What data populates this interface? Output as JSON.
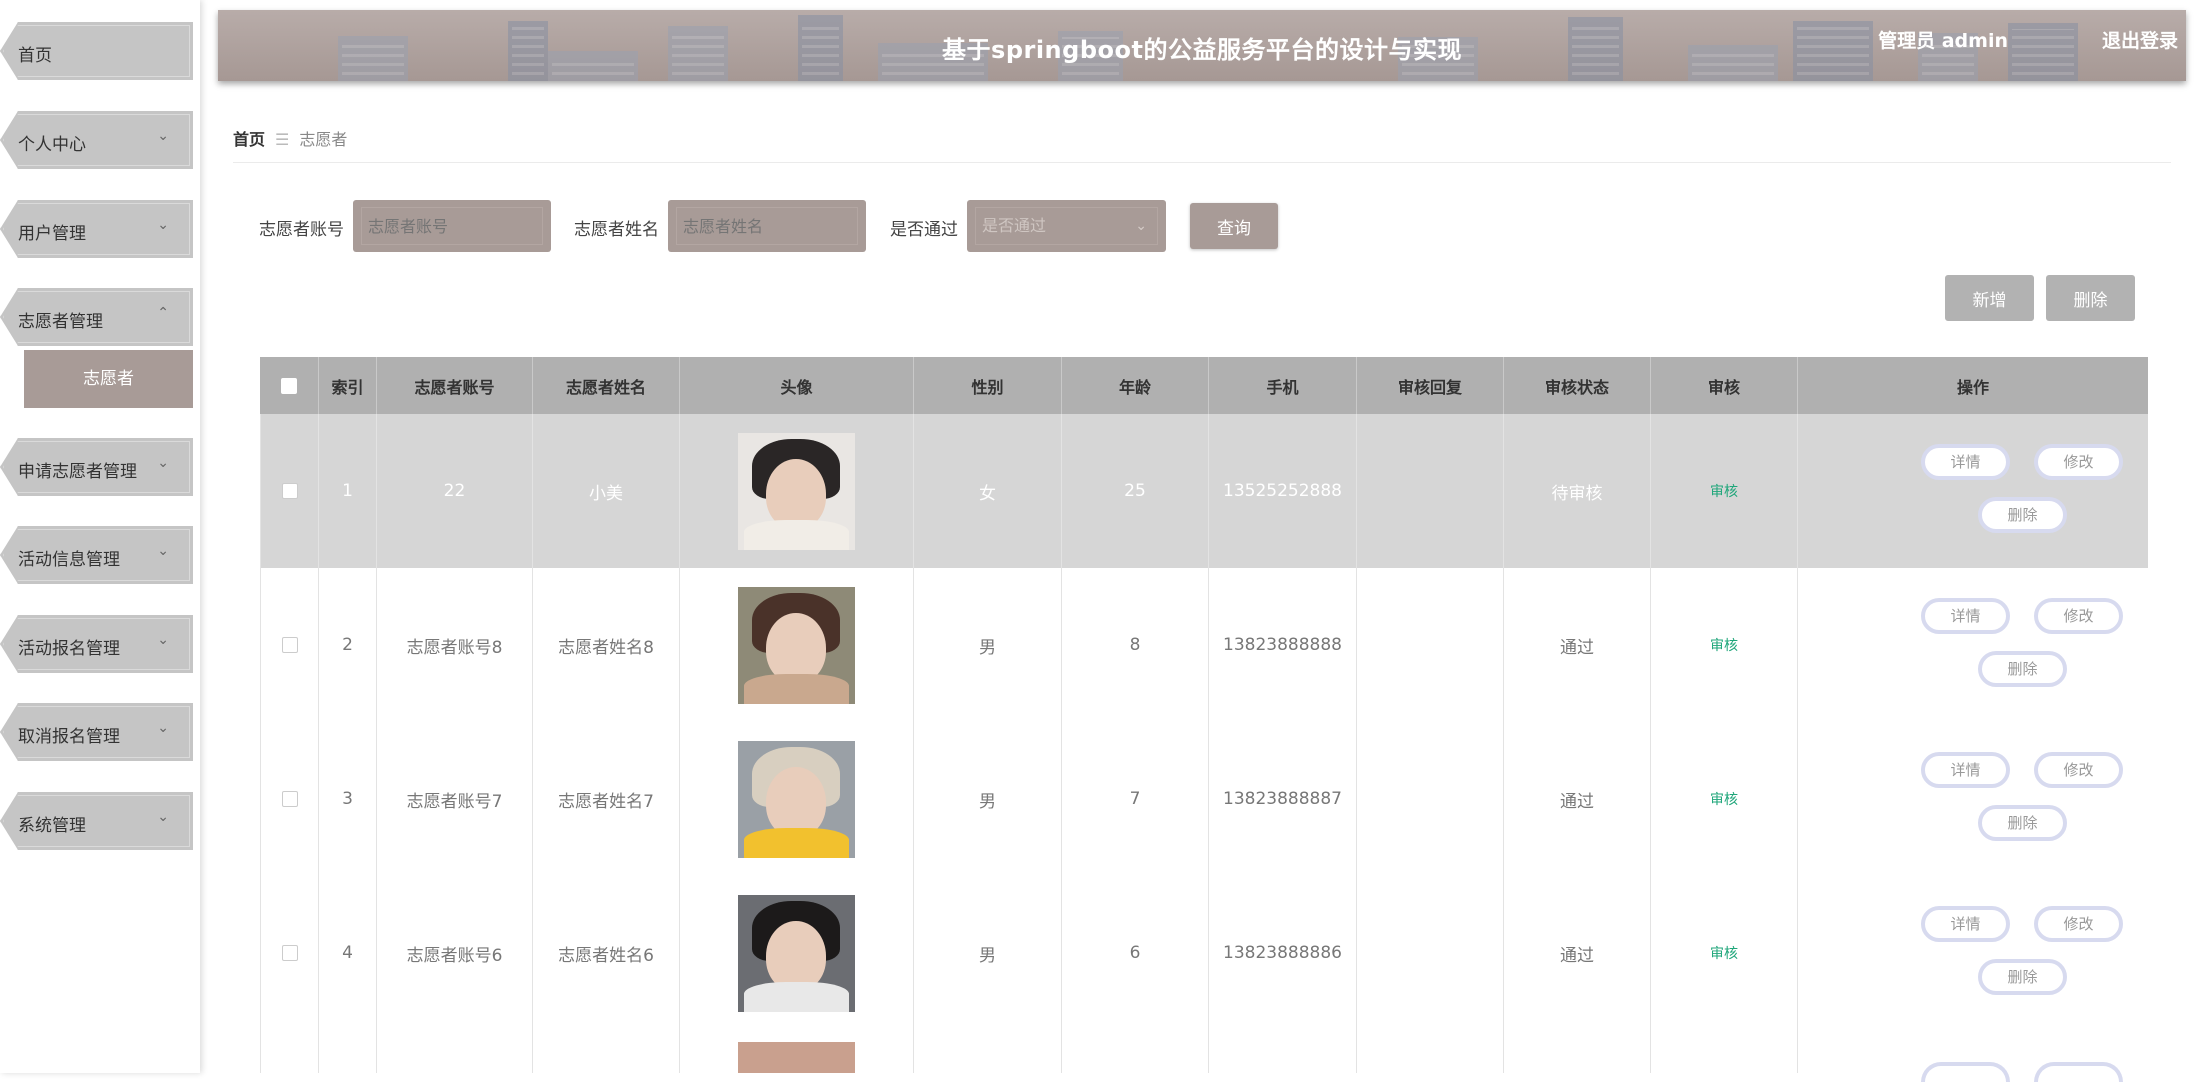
{
  "header": {
    "title": "基于springboot的公益服务平台的设计与实现",
    "user": "管理员 admin",
    "logout": "退出登录"
  },
  "sidebar": {
    "items": [
      {
        "label": "首页",
        "chevron": ""
      },
      {
        "label": "个人中心",
        "chevron": "⌄"
      },
      {
        "label": "用户管理",
        "chevron": "⌄"
      },
      {
        "label": "志愿者管理",
        "chevron": "⌃"
      },
      {
        "label": "申请志愿者管理",
        "chevron": "⌄"
      },
      {
        "label": "活动信息管理",
        "chevron": "⌄"
      },
      {
        "label": "活动报名管理",
        "chevron": "⌄"
      },
      {
        "label": "取消报名管理",
        "chevron": "⌄"
      },
      {
        "label": "系统管理",
        "chevron": "⌄"
      }
    ],
    "submenu_active": "志愿者"
  },
  "breadcrumb": {
    "home": "首页",
    "separator": "☰",
    "current": "志愿者"
  },
  "search": {
    "account_label": "志愿者账号",
    "account_placeholder": "志愿者账号",
    "name_label": "志愿者姓名",
    "name_placeholder": "志愿者姓名",
    "passed_label": "是否通过",
    "passed_placeholder": "是否通过",
    "query_button": "查询"
  },
  "actions": {
    "add": "新增",
    "delete": "删除"
  },
  "table": {
    "columns": [
      "索引",
      "志愿者账号",
      "志愿者姓名",
      "头像",
      "性别",
      "年龄",
      "手机",
      "审核回复",
      "审核状态",
      "审核",
      "操作"
    ],
    "rows": [
      {
        "index": "1",
        "account": "22",
        "name": "小美",
        "gender": "女",
        "age": "25",
        "phone": "13525252888",
        "reply": "",
        "status": "待审核",
        "audit": "审核",
        "avatar_hair": "#2a2626",
        "avatar_bg": "#e9e6e3",
        "avatar_body": "#f1ede7"
      },
      {
        "index": "2",
        "account": "志愿者账号8",
        "name": "志愿者姓名8",
        "gender": "男",
        "age": "8",
        "phone": "13823888888",
        "reply": "",
        "status": "通过",
        "audit": "审核",
        "avatar_hair": "#4a3229",
        "avatar_bg": "#8e8a77",
        "avatar_body": "#c9a88e"
      },
      {
        "index": "3",
        "account": "志愿者账号7",
        "name": "志愿者姓名7",
        "gender": "男",
        "age": "7",
        "phone": "13823888887",
        "reply": "",
        "status": "通过",
        "audit": "审核",
        "avatar_hair": "#d8cfc0",
        "avatar_bg": "#9aa0a6",
        "avatar_body": "#f2c12e"
      },
      {
        "index": "4",
        "account": "志愿者账号6",
        "name": "志愿者姓名6",
        "gender": "男",
        "age": "6",
        "phone": "13823888886",
        "reply": "",
        "status": "通过",
        "audit": "审核",
        "avatar_hair": "#1c1a1a",
        "avatar_bg": "#6b6d72",
        "avatar_body": "#e8e8e8"
      }
    ],
    "row_buttons": {
      "detail": "详情",
      "edit": "修改",
      "delete": "删除"
    }
  }
}
